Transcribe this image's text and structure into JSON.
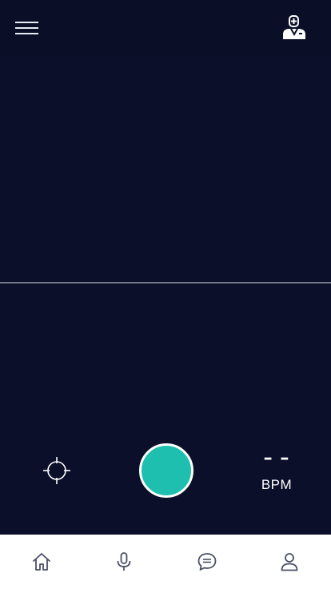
{
  "header": {
    "menu_icon": "hamburger-menu-icon",
    "profile_icon": "doctor-icon"
  },
  "monitor": {
    "waveform": "flat-line"
  },
  "controls": {
    "target_icon": "crosshair-icon",
    "record_color": "#1fbfaf",
    "bpm_value": "– –",
    "bpm_unit": "BPM"
  },
  "bottom_nav": {
    "items": [
      {
        "icon": "home-icon"
      },
      {
        "icon": "microphone-icon"
      },
      {
        "icon": "chat-icon"
      },
      {
        "icon": "profile-icon"
      }
    ]
  },
  "colors": {
    "background": "#0b0f2a",
    "accent": "#1fbfaf",
    "nav_background": "#ffffff",
    "nav_icon": "#4a4f66"
  }
}
